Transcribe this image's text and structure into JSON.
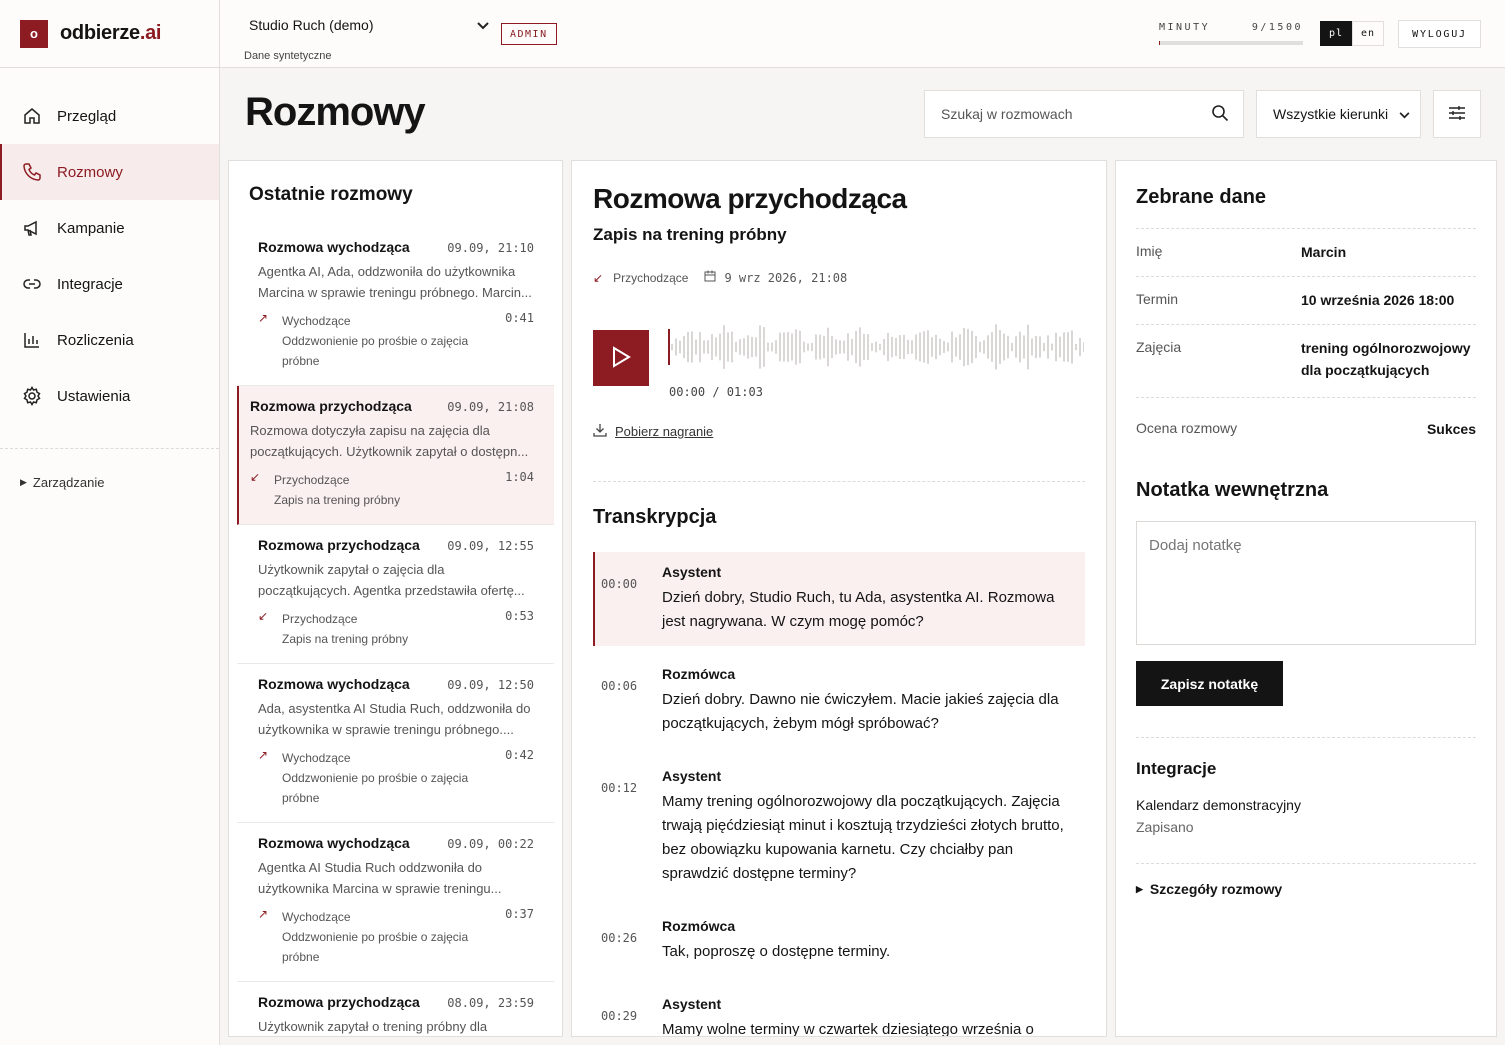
{
  "brand": {
    "mark": "o",
    "name": "odbierze",
    "suffix": ".ai",
    "accent": "#8c1c22"
  },
  "sidebar": {
    "items": [
      {
        "label": "Przegląd",
        "icon": "home-icon"
      },
      {
        "label": "Rozmowy",
        "icon": "phone-icon"
      },
      {
        "label": "Kampanie",
        "icon": "megaphone-icon"
      },
      {
        "label": "Integracje",
        "icon": "link-icon"
      },
      {
        "label": "Rozliczenia",
        "icon": "bar-chart-icon"
      },
      {
        "label": "Ustawienia",
        "icon": "gear-icon"
      }
    ],
    "manage_label": "Zarządzanie"
  },
  "topbar": {
    "studio": "Studio Ruch (demo)",
    "studio_sub": "Dane syntetyczne",
    "admin": "ADMIN",
    "minutes_label": "MINUTY",
    "minutes_value": "9/1500",
    "minutes_fraction": 0.006,
    "lang_pl": "pl",
    "lang_en": "en",
    "logout": "WYLOGUJ"
  },
  "header": {
    "title": "Rozmowy",
    "search_placeholder": "Szukaj w rozmowach",
    "direction_filter": "Wszystkie kierunki"
  },
  "list": {
    "title": "Ostatnie rozmowy",
    "calls": [
      {
        "title": "Rozmowa wychodząca",
        "time": "09.09, 21:10",
        "desc": "Agentka AI, Ada, oddzwoniła do użytkownika Marcina w sprawie treningu próbnego. Marcin...",
        "direction": "Wychodzące",
        "reason": "Oddzwonienie po prośbie o zajęcia próbne",
        "duration": "0:41"
      },
      {
        "title": "Rozmowa przychodząca",
        "time": "09.09, 21:08",
        "desc": "Rozmowa dotyczyła zapisu na zajęcia dla początkujących. Użytkownik zapytał o dostępn...",
        "direction": "Przychodzące",
        "reason": "Zapis na trening próbny",
        "duration": "1:04"
      },
      {
        "title": "Rozmowa przychodząca",
        "time": "09.09, 12:55",
        "desc": "Użytkownik zapytał o zajęcia dla początkujących. Agentka przedstawiła ofertę...",
        "direction": "Przychodzące",
        "reason": "Zapis na trening próbny",
        "duration": "0:53"
      },
      {
        "title": "Rozmowa wychodząca",
        "time": "09.09, 12:50",
        "desc": "Ada, asystentka AI Studia Ruch, oddzwoniła do użytkownika w sprawie treningu próbnego....",
        "direction": "Wychodzące",
        "reason": "Oddzwonienie po prośbie o zajęcia próbne",
        "duration": "0:42"
      },
      {
        "title": "Rozmowa wychodząca",
        "time": "09.09, 00:22",
        "desc": "Agentka AI Studia Ruch oddzwoniła do użytkownika Marcina w sprawie treningu...",
        "direction": "Wychodzące",
        "reason": "Oddzwonienie po prośbie o zajęcia próbne",
        "duration": "0:37"
      },
      {
        "title": "Rozmowa przychodząca",
        "time": "08.09, 23:59",
        "desc": "Użytkownik zapytał o trening próbny dla",
        "direction": "",
        "reason": "",
        "duration": ""
      }
    ]
  },
  "detail": {
    "title": "Rozmowa przychodząca",
    "subtitle": "Zapis na trening próbny",
    "direction": "Przychodzące",
    "datetime": "9 wrz 2026, 21:08",
    "timecode": "00:00 / 01:03",
    "download": "Pobierz nagranie",
    "transcript_title": "Transkrypcja",
    "segments": [
      {
        "t": "00:00",
        "who": "Asystent",
        "text": "Dzień dobry, Studio Ruch, tu Ada, asystentka AI. Rozmowa jest nagrywana. W czym mogę pomóc?"
      },
      {
        "t": "00:06",
        "who": "Rozmówca",
        "text": "Dzień dobry. Dawno nie ćwiczyłem. Macie jakieś zajęcia dla początkujących, żebym mógł spróbować?"
      },
      {
        "t": "00:12",
        "who": "Asystent",
        "text": "Mamy trening ogólnorozwojowy dla początkujących. Zajęcia trwają pięćdziesiąt minut i kosztują trzydzieści złotych brutto, bez obowiązku kupowania karnetu. Czy chciałby pan sprawdzić dostępne terminy?"
      },
      {
        "t": "00:26",
        "who": "Rozmówca",
        "text": "Tak, poproszę o dostępne terminy."
      },
      {
        "t": "00:29",
        "who": "Asystent",
        "text": "Mamy wolne terminy w czwartek dziesiątego września o"
      }
    ]
  },
  "data_panel": {
    "title": "Zebrane dane",
    "fields": [
      {
        "k": "Imię",
        "v": "Marcin"
      },
      {
        "k": "Termin",
        "v": "10 września 2026 18:00"
      },
      {
        "k": "Zajęcia",
        "v": "trening ogólnorozwojowy dla początkujących"
      },
      {
        "k": "Ocena rozmowy",
        "v": "Sukces"
      }
    ],
    "note_title": "Notatka wewnętrzna",
    "note_placeholder": "Dodaj notatkę",
    "save": "Zapisz notatkę",
    "integrations_title": "Integracje",
    "integration_name": "Kalendarz demonstracyjny",
    "integration_status": "Zapisano",
    "details_label": "Szczegóły rozmowy"
  }
}
